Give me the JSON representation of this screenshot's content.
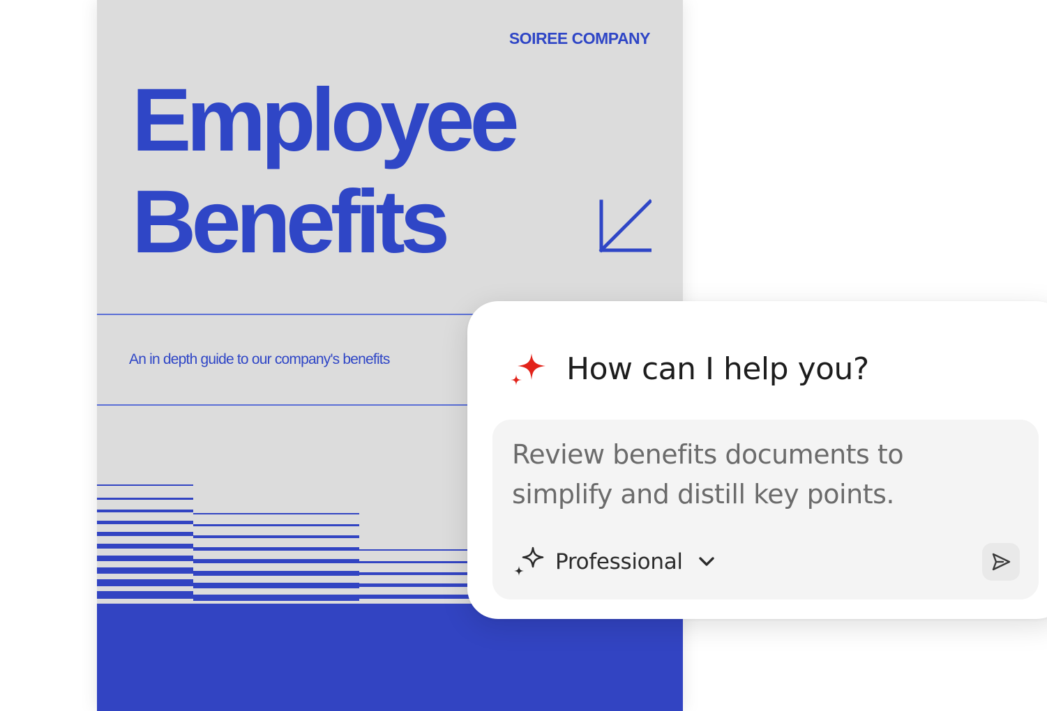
{
  "document": {
    "brand": "SOIREE COMPANY",
    "title_line1": "Employee",
    "title_line2": "Benefits",
    "subtitle": "An in depth guide to our company's benefits",
    "icons": [
      "arrow-down-left-icon"
    ]
  },
  "assistant": {
    "heading": "How can I help you?",
    "prompt": "Review benefits documents to simplify and distill key points.",
    "tone_label": "Professional",
    "icons": [
      "sparkle-icon",
      "tone-sparkle-icon",
      "chevron-down-icon",
      "send-icon"
    ]
  },
  "colors": {
    "cover_background": "#dcdcdc",
    "brand_blue": "#2f46c6",
    "sparkle_red": "#e2231a",
    "card_background": "#ffffff",
    "prompt_background": "#f4f4f4"
  }
}
